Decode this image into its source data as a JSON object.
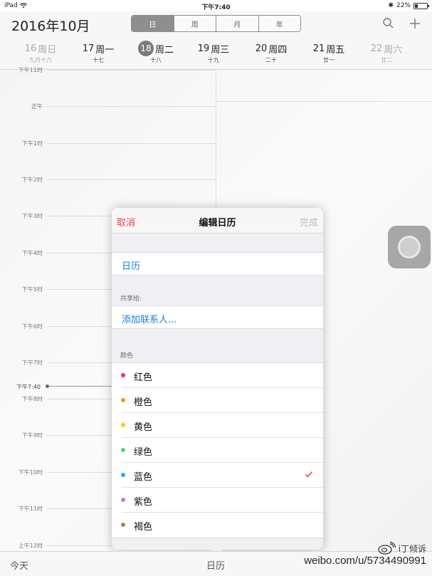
{
  "status": {
    "device": "iPad",
    "time": "下午7:40",
    "battery": "22%"
  },
  "header": {
    "month_title": "2016年10月",
    "segments": [
      {
        "label": "日",
        "active": true
      },
      {
        "label": "周",
        "active": false
      },
      {
        "label": "月",
        "active": false
      },
      {
        "label": "年",
        "active": false
      }
    ],
    "days": [
      {
        "num": "16",
        "weekday": "周日",
        "lunar": "九月十六",
        "dim": true
      },
      {
        "num": "17",
        "weekday": "周一",
        "lunar": "十七",
        "dim": false
      },
      {
        "num": "18",
        "weekday": "周二",
        "lunar": "十八",
        "dim": false,
        "today": true
      },
      {
        "num": "19",
        "weekday": "周三",
        "lunar": "十九",
        "dim": false
      },
      {
        "num": "20",
        "weekday": "周四",
        "lunar": "二十",
        "dim": false
      },
      {
        "num": "21",
        "weekday": "周五",
        "lunar": "廿一",
        "dim": false
      },
      {
        "num": "22",
        "weekday": "周六",
        "lunar": "廿二",
        "dim": true
      }
    ]
  },
  "timeline": {
    "hours": [
      "下午11时",
      "正午",
      "下午1时",
      "下午2时",
      "下午3时",
      "下午4时",
      "下午5时",
      "下午6时",
      "下午7时",
      "下午8时",
      "下午9时",
      "下午10时",
      "下午11时",
      "上午12时"
    ],
    "now_label": "下午7:40"
  },
  "popover": {
    "cancel": "取消",
    "title": "编辑日历",
    "done": "完成",
    "calendar_name": "日历",
    "share_header": "共享给:",
    "add_contact": "添加联系人...",
    "color_header": "颜色",
    "colors": [
      {
        "name": "红色",
        "hex": "#ff2d55",
        "selected": false
      },
      {
        "name": "橙色",
        "hex": "#ff9500",
        "selected": false
      },
      {
        "name": "黄色",
        "hex": "#ffcc00",
        "selected": false
      },
      {
        "name": "绿色",
        "hex": "#4cd964",
        "selected": false
      },
      {
        "name": "蓝色",
        "hex": "#1badf8",
        "selected": true
      },
      {
        "name": "紫色",
        "hex": "#cc73e1",
        "selected": false
      },
      {
        "name": "褐色",
        "hex": "#a2845e",
        "selected": false
      }
    ],
    "check_color": "#e8463e"
  },
  "toolbar": {
    "today": "今天",
    "calendars": "日历"
  },
  "watermark": {
    "url": "weibo.com/u/5734490991",
    "handle": "i丁倾诉"
  }
}
